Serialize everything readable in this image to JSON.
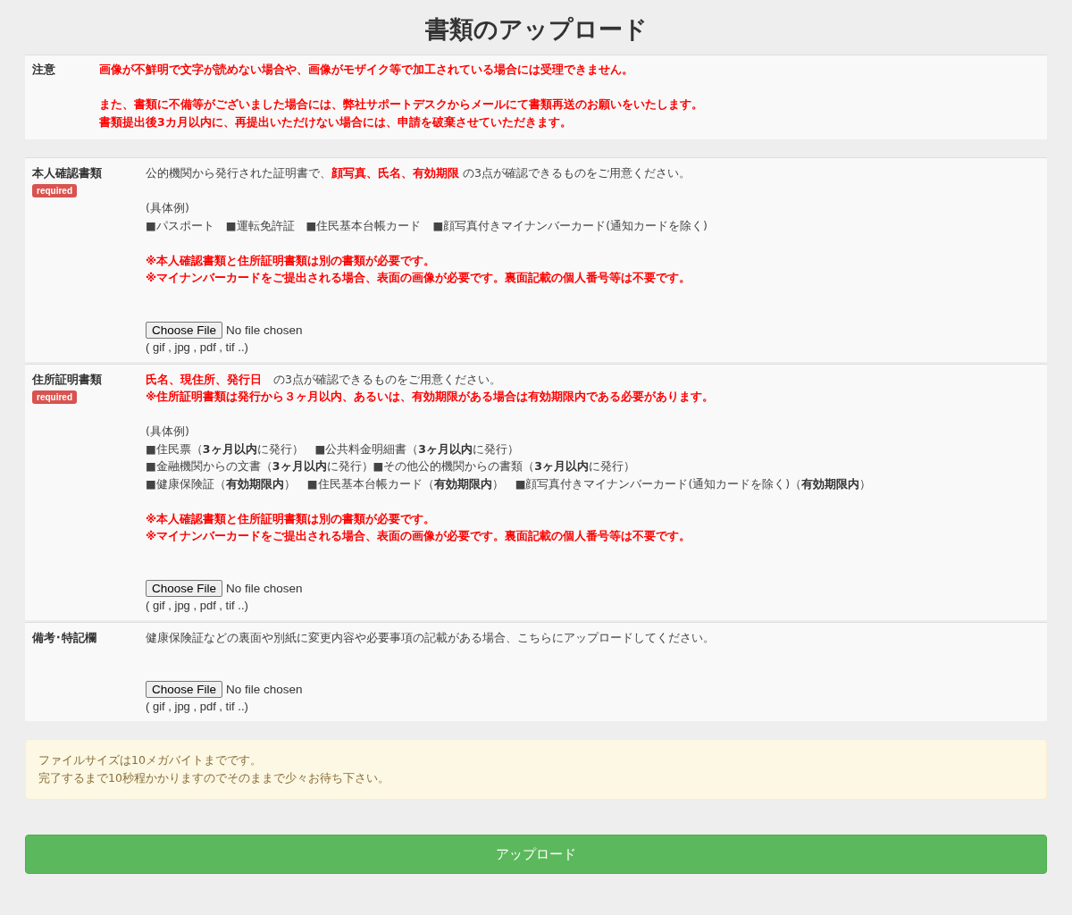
{
  "title": "書類のアップロード",
  "notice": {
    "label": "注意",
    "blocks": [
      [
        "画像が不鮮明で文字が読めない場合や、画像がモザイク等で加工されている場合には受理できません。"
      ],
      [
        "また、書類に不備等がございました場合には、弊社サポートデスクからメールにて書類再送のお願いをいたします。",
        "書類提出後3カ月以内に、再提出いただけない場合には、申請を破棄させていただきます。"
      ]
    ]
  },
  "sections": [
    {
      "label": "本人確認書類",
      "required": true,
      "required_badge": "required",
      "blocks": [
        [
          {
            "kind": "lead",
            "text": "公的機関から発行された証明書で、**顔写真、氏名、有効期限** の3点が確認できるものをご用意ください。"
          }
        ],
        [
          {
            "kind": "normal",
            "text": "(具体例)"
          },
          {
            "kind": "normal",
            "text": "■パスポート　■運転免許証　■住民基本台帳カード　■顔写真付きマイナンバーカード(通知カードを除く)"
          }
        ],
        [
          {
            "kind": "warning",
            "text": "※本人確認書類と住所証明書類は別の書類が必要です。"
          },
          {
            "kind": "warning",
            "text": "※マイナンバーカードをご提出される場合、表面の画像が必要です。裏面記載の個人番号等は不要です。"
          }
        ]
      ],
      "file_button": "Choose File",
      "file_status": "No file chosen",
      "formats": "( gif , jpg , pdf , tif ..)"
    },
    {
      "label": "住所証明書類",
      "required": true,
      "required_badge": "required",
      "blocks": [
        [
          {
            "kind": "lead",
            "text": "**氏名、現住所、発行日**　の3点が確認できるものをご用意ください。"
          },
          {
            "kind": "warning",
            "text": "※住所証明書類は発行から３ヶ月以内、あるいは、有効期限がある場合は有効期限内である必要があります。"
          }
        ],
        [
          {
            "kind": "normal",
            "text": "(具体例)"
          },
          {
            "kind": "normal",
            "text": "■住民票（**3ヶ月以内**に発行）　■公共料金明細書（**3ヶ月以内**に発行）"
          },
          {
            "kind": "normal",
            "text": "■金融機関からの文書（**3ヶ月以内**に発行）■その他公的機関からの書類（**3ヶ月以内**に発行）"
          },
          {
            "kind": "normal",
            "text": "■健康保険証（**有効期限内**）　■住民基本台帳カード（**有効期限内**）　■顔写真付きマイナンバーカード(通知カードを除く)（**有効期限内**）"
          }
        ],
        [
          {
            "kind": "warning",
            "text": "※本人確認書類と住所証明書類は別の書類が必要です。"
          },
          {
            "kind": "warning",
            "text": "※マイナンバーカードをご提出される場合、表面の画像が必要です。裏面記載の個人番号等は不要です。"
          }
        ]
      ],
      "file_button": "Choose File",
      "file_status": "No file chosen",
      "formats": "( gif , jpg , pdf , tif ..)"
    },
    {
      "label": "備考･特記欄",
      "required": false,
      "blocks": [
        [
          {
            "kind": "normal",
            "text": "健康保険証などの裏面や別紙に変更内容や必要事項の記載がある場合、こちらにアップロードしてください。"
          }
        ]
      ],
      "file_button": "Choose File",
      "file_status": "No file chosen",
      "formats": "( gif , jpg , pdf , tif ..)"
    }
  ],
  "info": [
    "ファイルサイズは10メガバイトまでです。",
    "完了するまで10秒程かかりますのでそのままで少々お待ち下さい。"
  ],
  "submit": "アップロード"
}
